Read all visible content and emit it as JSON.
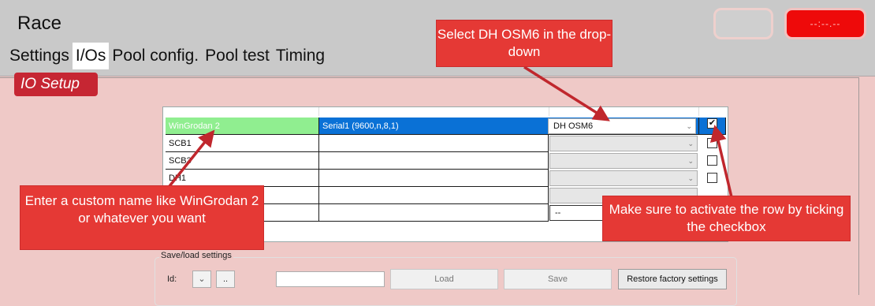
{
  "app": {
    "title": "Race"
  },
  "tabs": [
    {
      "label": "Settings"
    },
    {
      "label": "I/Os"
    },
    {
      "label": "Pool config."
    },
    {
      "label": "Pool test"
    },
    {
      "label": "Timing"
    }
  ],
  "header": {
    "clock": "--:--.--"
  },
  "section": {
    "title": "IO Setup"
  },
  "io_table": {
    "rows": [
      {
        "name": "WinGrodan 2",
        "port": "Serial1 (9600,n,8,1)",
        "device": "DH OSM6",
        "checked": true
      },
      {
        "name": "SCB1",
        "port": "",
        "device": "",
        "checked": false
      },
      {
        "name": "SCB3",
        "port": "",
        "device": "",
        "checked": false
      },
      {
        "name": "DH1",
        "port": "",
        "device": "",
        "checked": false
      },
      {
        "name": "",
        "port": "",
        "device": "",
        "checked": false
      },
      {
        "name": "",
        "port": "",
        "device": "--",
        "checked": false
      }
    ]
  },
  "save_load": {
    "legend": "Save/load settings",
    "id_label": "Id:",
    "ellipsis": "..",
    "filename_value": "",
    "load": "Load",
    "save": "Save",
    "restore": "Restore factory settings"
  },
  "callouts": {
    "dropdown": "Select DH OSM6 in the drop-down",
    "name": "Enter a custom name like WinGrodan 2 or whatever you want",
    "checkbox": "Make sure to activate the row by ticking the checkbox"
  },
  "icons": {
    "chevron": "chevron-down-icon",
    "check": "check-icon"
  }
}
